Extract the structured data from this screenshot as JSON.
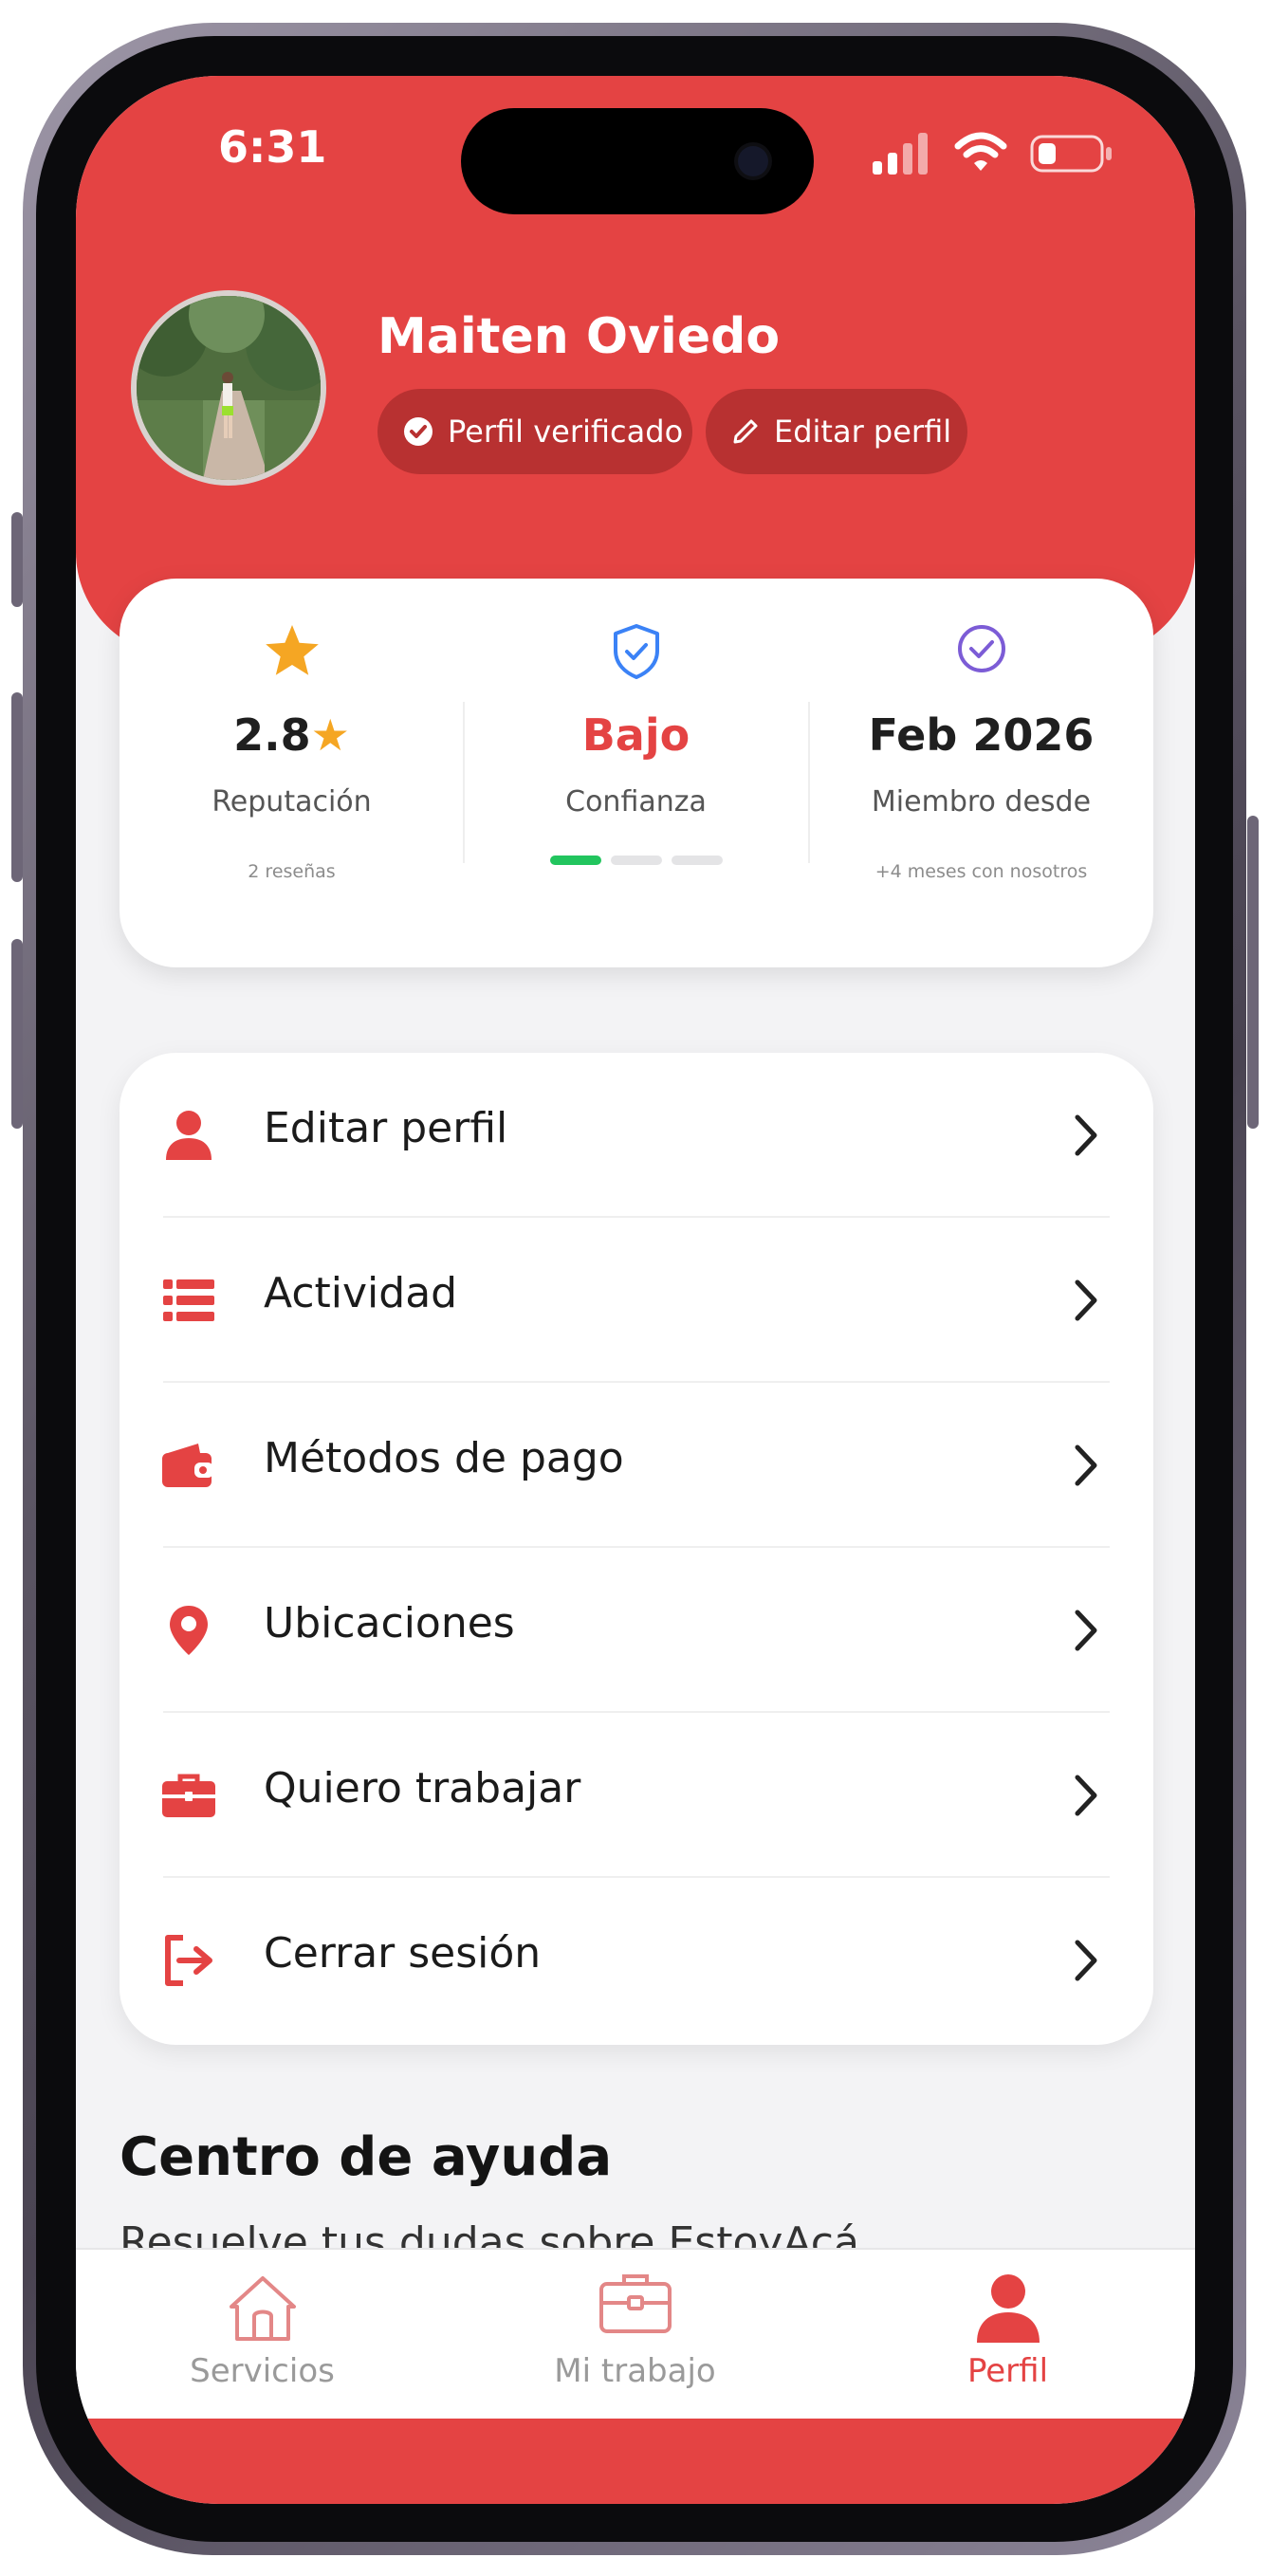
{
  "status_bar": {
    "time": "6:31",
    "icons": [
      "signal-icon",
      "wifi-icon",
      "battery-icon"
    ]
  },
  "profile": {
    "name": "Maiten Oviedo",
    "verified_label": "Perfil verificado",
    "edit_label": "Editar perfil"
  },
  "stats": {
    "reputation": {
      "value": "2.8",
      "label": "Reputación",
      "sub": "2 reseñas"
    },
    "trust": {
      "value": "Bajo",
      "label": "Confianza",
      "level": 1,
      "max_level": 3
    },
    "member": {
      "value": "Feb 2026",
      "label": "Miembro desde",
      "sub": "+4 meses con nosotros"
    }
  },
  "menu": [
    {
      "label": "Editar perfil",
      "icon": "user-icon"
    },
    {
      "label": "Actividad",
      "icon": "list-icon"
    },
    {
      "label": "Métodos de pago",
      "icon": "wallet-icon"
    },
    {
      "label": "Ubicaciones",
      "icon": "location-pin-icon"
    },
    {
      "label": "Quiero trabajar",
      "icon": "briefcase-icon"
    },
    {
      "label": "Cerrar sesión",
      "icon": "logout-icon"
    }
  ],
  "help": {
    "title": "Centro de ayuda",
    "subtitle": "Resuelve tus dudas sobre EstoyAcá"
  },
  "tabs": [
    {
      "label": "Servicios",
      "icon": "home-icon",
      "active": false
    },
    {
      "label": "Mi trabajo",
      "icon": "briefcase-icon",
      "active": false
    },
    {
      "label": "Perfil",
      "icon": "user-icon",
      "active": true
    }
  ],
  "colors": {
    "accent": "#e44343",
    "accent_dark": "#b83131",
    "star": "#f5a623",
    "shield": "#3b82f6",
    "member_check": "#7c5cd6",
    "trust_bar": "#22c55e"
  }
}
